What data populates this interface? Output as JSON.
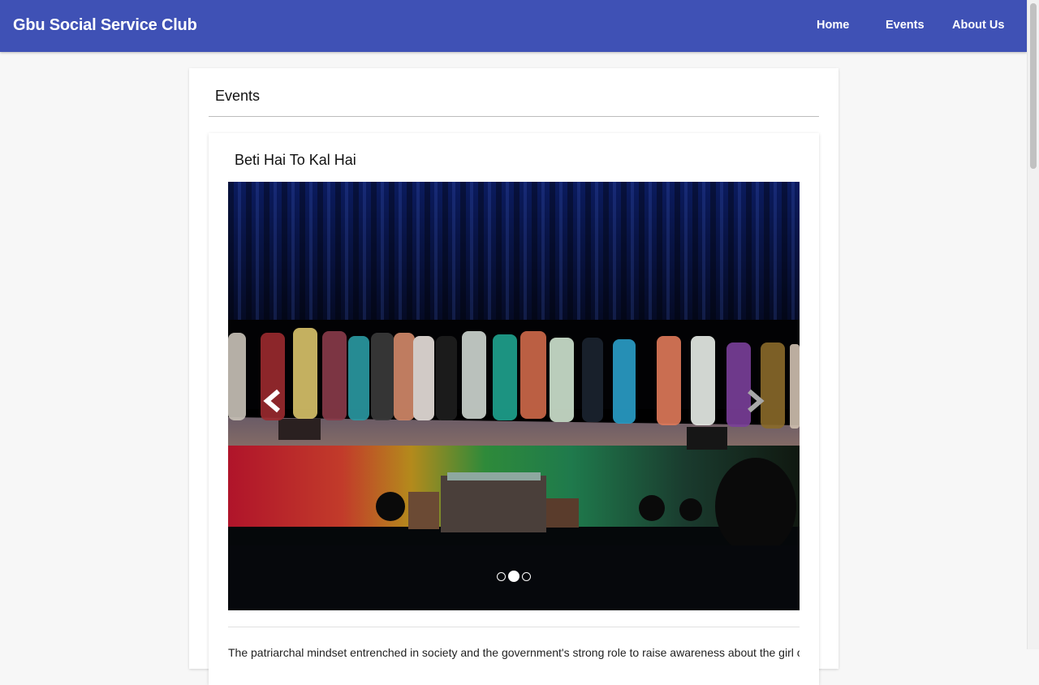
{
  "header": {
    "brand": "Gbu Social Service Club",
    "nav": {
      "home": "Home",
      "events": "Events",
      "about": "About Us"
    },
    "color": "#3f51b5"
  },
  "page": {
    "section_title": "Events"
  },
  "event": {
    "title": "Beti Hai To Kal Hai",
    "description": "The patriarchal mindset entrenched in society and the government's strong role to raise awareness about the girl child issues.",
    "carousel": {
      "slide_count": 3,
      "active_slide": 2,
      "prev_icon": "chevron-left-icon",
      "next_icon": "chevron-right-icon"
    }
  }
}
